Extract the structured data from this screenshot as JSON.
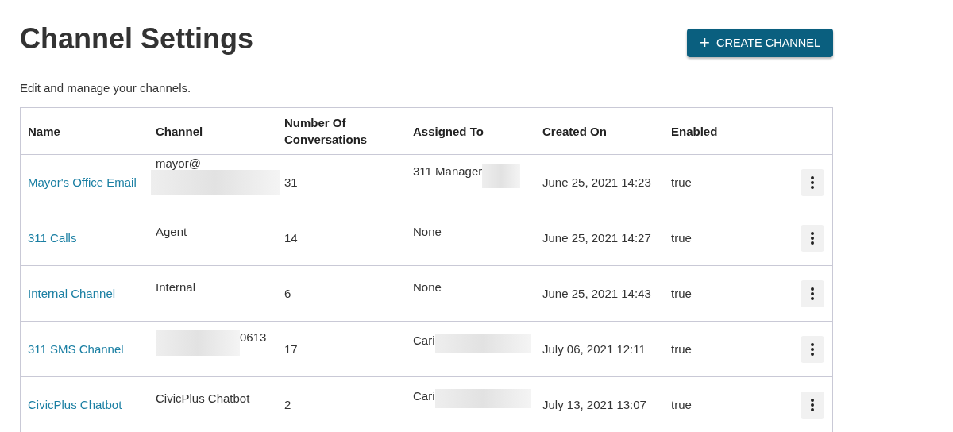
{
  "title": "Channel Settings",
  "create_button": {
    "icon": "+",
    "label": "CREATE CHANNEL"
  },
  "subtitle": "Edit and manage your channels.",
  "table": {
    "columns": [
      "Name",
      "Channel",
      "Number Of Conversations",
      "Assigned To",
      "Created On",
      "Enabled"
    ],
    "rows": [
      {
        "name": "Mayor's Office Email",
        "channel": [
          {
            "kind": "text",
            "text": "mayor@"
          },
          {
            "kind": "redaction"
          }
        ],
        "conversations": "31",
        "assigned_to": [
          {
            "kind": "text",
            "text": "311 Manager"
          },
          {
            "kind": "redaction"
          }
        ],
        "created_on": "June 25, 2021 14:23",
        "enabled": "true"
      },
      {
        "name": "311 Calls",
        "channel": [
          {
            "kind": "text",
            "text": "Agent"
          }
        ],
        "conversations": "14",
        "assigned_to": [
          {
            "kind": "text",
            "text": "None"
          }
        ],
        "created_on": "June 25, 2021 14:27",
        "enabled": "true"
      },
      {
        "name": "Internal Channel",
        "channel": [
          {
            "kind": "text",
            "text": "Internal"
          }
        ],
        "conversations": "6",
        "assigned_to": [
          {
            "kind": "text",
            "text": "None"
          }
        ],
        "created_on": "June 25, 2021 14:43",
        "enabled": "true"
      },
      {
        "name": "311 SMS Channel",
        "channel": [
          {
            "kind": "redaction"
          },
          {
            "kind": "text",
            "text": "0613"
          }
        ],
        "conversations": "17",
        "assigned_to": [
          {
            "kind": "text",
            "text": "Cari"
          },
          {
            "kind": "redaction"
          }
        ],
        "created_on": "July 06, 2021 12:11",
        "enabled": "true"
      },
      {
        "name": "CivicPlus Chatbot",
        "channel": [
          {
            "kind": "text",
            "text": "CivicPlus Chatbot"
          }
        ],
        "conversations": "2",
        "assigned_to": [
          {
            "kind": "text",
            "text": "Cari"
          },
          {
            "kind": "redaction"
          }
        ],
        "created_on": "July 13, 2021 13:07",
        "enabled": "true"
      }
    ]
  }
}
